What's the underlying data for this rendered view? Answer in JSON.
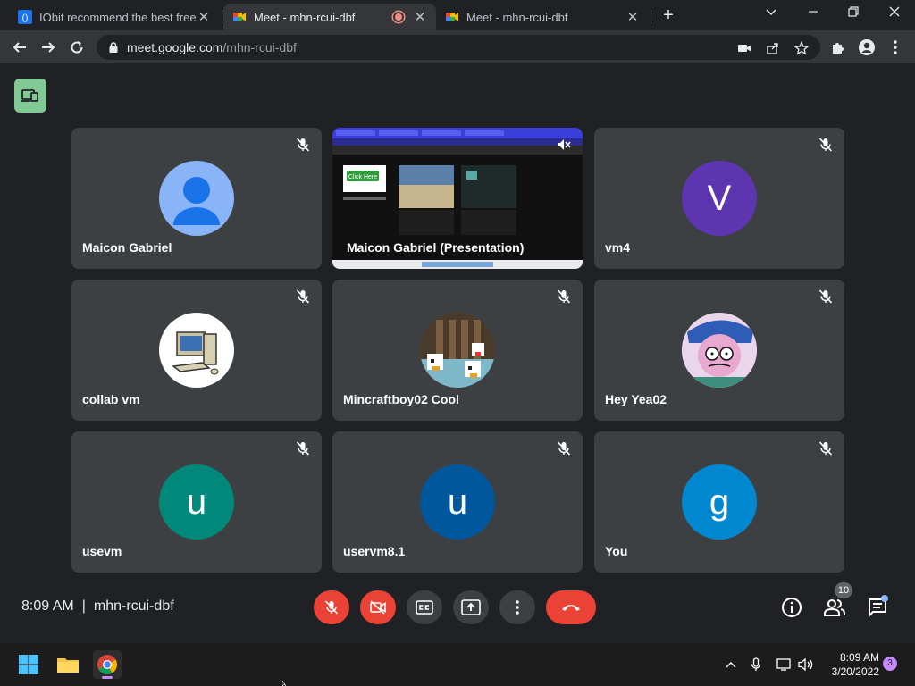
{
  "browser": {
    "tabs": [
      {
        "title": "IObit recommend the best free, f",
        "active": false
      },
      {
        "title": "Meet - mhn-rcui-dbf",
        "active": true,
        "recording": true
      },
      {
        "title": "Meet - mhn-rcui-dbf",
        "active": false
      }
    ],
    "url_host": "meet.google.com",
    "url_path": "/mhn-rcui-dbf"
  },
  "meet": {
    "tiles": [
      {
        "name": "Maicon Gabriel",
        "avatar_type": "default-person",
        "avatar_color": "#8ab4f8"
      },
      {
        "name": "Maicon Gabriel (Presentation)",
        "avatar_type": "screen-share"
      },
      {
        "name": "vm4",
        "avatar_letter": "V",
        "avatar_color": "#5e35b1"
      },
      {
        "name": "collab vm",
        "avatar_type": "computer-image"
      },
      {
        "name": "Mincraftboy02 Cool",
        "avatar_type": "minecraft-image"
      },
      {
        "name": "Hey Yea02",
        "avatar_type": "cartoon-image"
      },
      {
        "name": "usevm",
        "avatar_letter": "u",
        "avatar_color": "#00897b"
      },
      {
        "name": "uservm8.1",
        "avatar_letter": "u",
        "avatar_color": "#01579b"
      },
      {
        "name": "You",
        "avatar_letter": "g",
        "avatar_color": "#0288d1"
      }
    ],
    "presentation_thumb": {
      "button_label": "Click Here"
    },
    "time": "8:09 AM",
    "meeting_code": "mhn-rcui-dbf",
    "participants_count": "10"
  },
  "taskbar": {
    "time": "8:09 AM",
    "date": "3/20/2022",
    "notifications": "3"
  },
  "colors": {
    "mute_red": "#ea4335",
    "meet_bg": "#202124",
    "tile_bg": "#3c4043"
  }
}
